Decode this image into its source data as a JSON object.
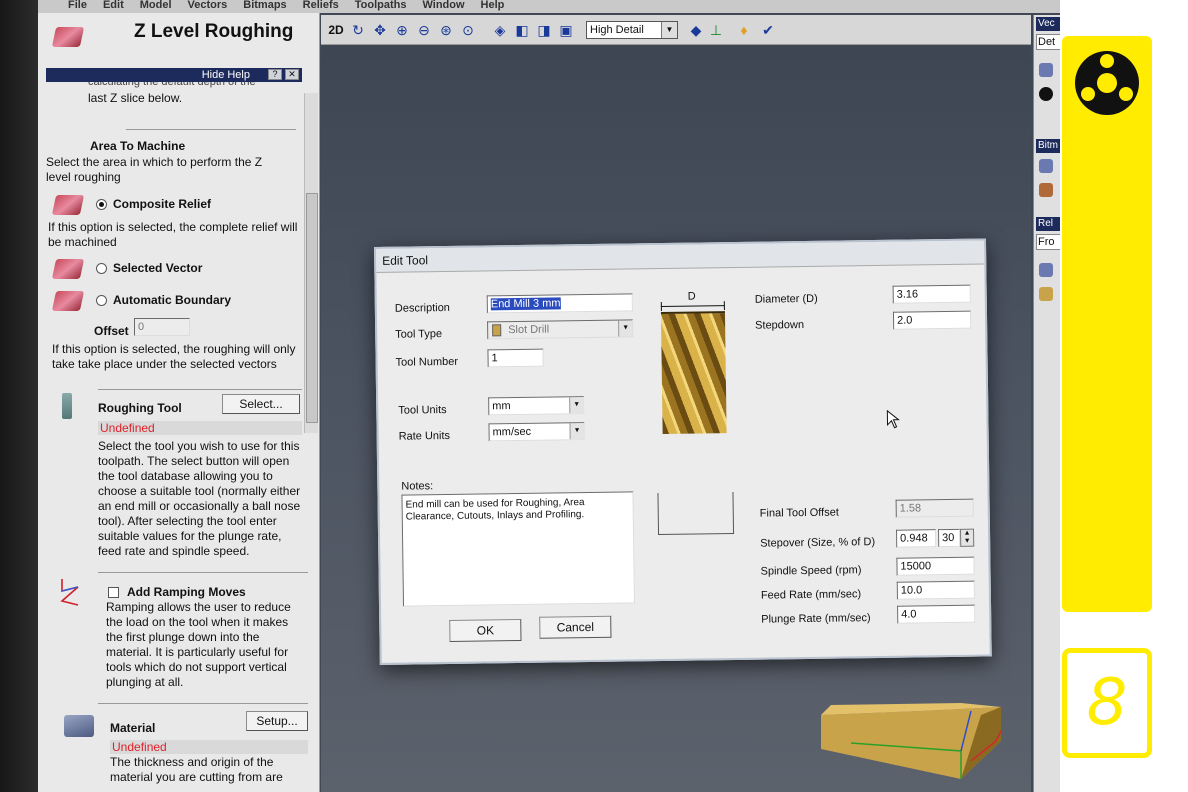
{
  "menu": [
    "File",
    "Edit",
    "Model",
    "Vectors",
    "Bitmaps",
    "Reliefs",
    "Toolpaths",
    "Window",
    "Help"
  ],
  "panel": {
    "title": "Z Level Roughing",
    "hide_help": "Hide Help",
    "help_btn": "?",
    "close_btn": "✕",
    "cutoff_text": "calculating the default depth of the",
    "last_z_text": "last Z slice below.",
    "area_heading": "Area To Machine",
    "area_desc": "Select the area in which to perform the Z level roughing",
    "opt_composite": "Composite Relief",
    "composite_desc": "If this option is selected, the complete relief will be machined",
    "opt_selected_vector": "Selected Vector",
    "opt_auto_boundary": "Automatic Boundary",
    "offset_label": "Offset",
    "offset_value": "0",
    "vector_desc": "If this option is selected, the roughing will only take take place under the selected vectors",
    "roughing_tool_label": "Roughing Tool",
    "select_btn": "Select...",
    "roughing_tool_value": "Undefined",
    "roughing_tool_desc": "Select the tool you wish to use for this toolpath. The select button will open the tool database allowing you to choose a suitable tool (normally either an end mill or occasionally a ball nose tool). After selecting the tool enter suitable values for the plunge rate, feed rate and spindle speed.",
    "ramping_label": "Add Ramping Moves",
    "ramping_desc": "Ramping allows the user to reduce the load on the tool when it makes the first plunge down into the material. It is particularly useful for tools which do not support vertical plunging at all.",
    "material_label": "Material",
    "setup_btn": "Setup...",
    "material_value": "Undefined",
    "material_desc": "The thickness and origin of the material you are cutting from are"
  },
  "toolbar": {
    "view_2d": "2D",
    "detail_value": "High Detail"
  },
  "right_panel": {
    "tab1": "Vec",
    "field1": "Det",
    "tab2": "Bitm",
    "tab3": "Rel",
    "field3": "Fro"
  },
  "dialog": {
    "title": "Edit Tool",
    "description_label": "Description",
    "description_value": "End Mill 3 mm",
    "tool_type_label": "Tool Type",
    "tool_type_value": "Slot Drill",
    "tool_number_label": "Tool Number",
    "tool_number_value": "1",
    "tool_units_label": "Tool Units",
    "tool_units_value": "mm",
    "rate_units_label": "Rate Units",
    "rate_units_value": "mm/sec",
    "diagram_label": "D",
    "diameter_label": "Diameter (D)",
    "diameter_value": "3.16",
    "stepdown_label": "Stepdown",
    "stepdown_value": "2.0",
    "notes_label": "Notes:",
    "notes_value": "End mill can be used for Roughing, Area Clearance, Cutouts, Inlays and Profiling.",
    "final_offset_label": "Final Tool Offset",
    "final_offset_value": "1.58",
    "stepover_label": "Stepover (Size, % of D)",
    "stepover_size": "0.948",
    "stepover_pct": "30",
    "spindle_label": "Spindle Speed (rpm)",
    "spindle_value": "15000",
    "feed_label": "Feed Rate (mm/sec)",
    "feed_value": "10.0",
    "plunge_label": "Plunge Rate (mm/sec)",
    "plunge_value": "4.0",
    "ok_btn": "OK",
    "cancel_btn": "Cancel"
  },
  "brand": {
    "number": "8",
    "accent": "#ffec00"
  }
}
